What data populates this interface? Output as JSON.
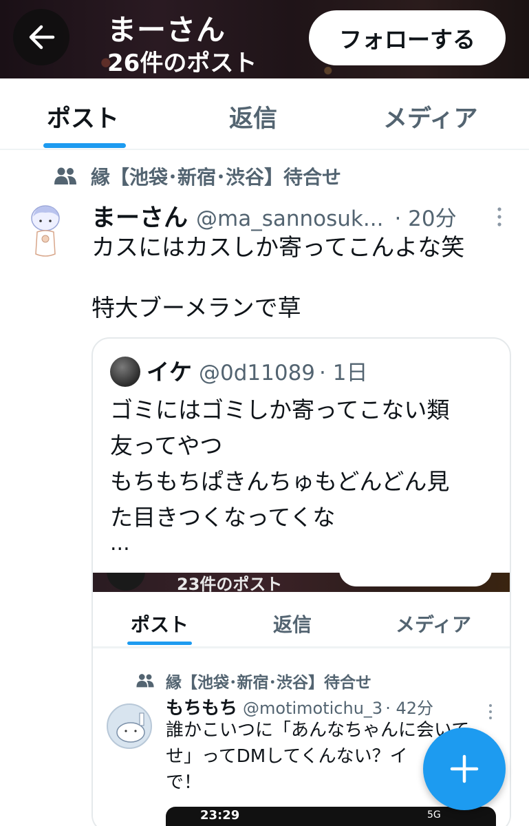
{
  "header": {
    "profile_name": "まーさん",
    "post_count": "26件のポスト",
    "follow_label": "フォローする"
  },
  "tabs": [
    {
      "label": "ポスト",
      "active": true
    },
    {
      "label": "返信",
      "active": false
    },
    {
      "label": "メディア",
      "active": false
    }
  ],
  "post": {
    "community": "縁【池袋･新宿･渋谷】待合せ",
    "author_name": "まーさん",
    "author_handle": "@ma_sannosuk...",
    "time": "· 20分",
    "text": "カスにはカスしか寄ってこんよな笑\n\n特大ブーメランで草"
  },
  "quote": {
    "author_name": "イケ",
    "author_handle": "@0d11089",
    "time": "· 1日",
    "text": "ゴミにはゴミしか寄ってこない類\n友ってやつ\nもちもちぱきんちゅもどんどん見\nた目きつくなってくな",
    "ellipsis": "...",
    "screenshot": {
      "post_count": "23件のポスト",
      "tabs": [
        {
          "label": "ポスト",
          "active": true
        },
        {
          "label": "返信",
          "active": false
        },
        {
          "label": "メディア",
          "active": false
        }
      ],
      "community": "縁【池袋･新宿･渋谷】待合せ",
      "author_name": "もちもち",
      "author_handle": "@motimotichu_3",
      "time": "· 42分",
      "text": "誰かこいつに「あんなちゃんに会いて\nせ」ってDMしてくんない？イ\nで！",
      "media_clock": "23:29",
      "media_status": "5G"
    }
  },
  "colors": {
    "accent": "#1d9bf0",
    "text_primary": "#0f1419",
    "text_secondary": "#536471"
  },
  "icons": {
    "back": "arrow-left-icon",
    "community": "people-icon",
    "more": "more-vertical-icon",
    "fab": "plus-icon"
  }
}
